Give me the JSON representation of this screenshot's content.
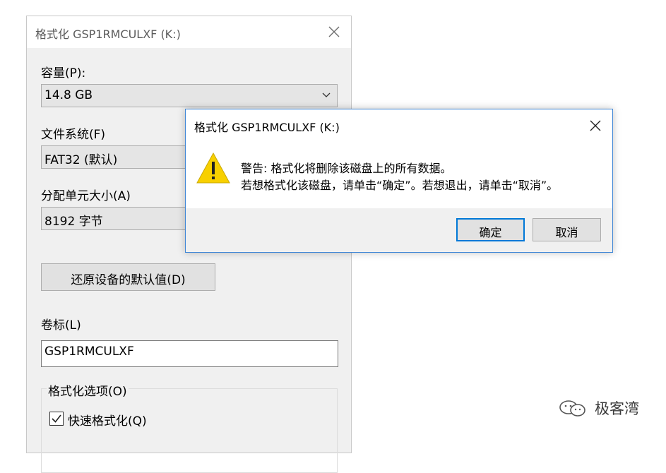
{
  "format_window": {
    "title": "格式化 GSP1RMCULXF (K:)",
    "capacity_label": "容量(P):",
    "capacity_value": "14.8 GB",
    "filesystem_label": "文件系统(F)",
    "filesystem_value": "FAT32 (默认)",
    "allocation_label": "分配单元大小(A)",
    "allocation_value": "8192 字节",
    "restore_defaults_label": "还原设备的默认值(D)",
    "volume_label_label": "卷标(L)",
    "volume_label_value": "GSP1RMCULXF",
    "format_options_label": "格式化选项(O)",
    "quick_format_label": "快速格式化(Q)",
    "quick_format_checked": true
  },
  "warning_dialog": {
    "title": "格式化 GSP1RMCULXF (K:)",
    "icon": "warning-icon",
    "message_line1": "警告: 格式化将删除该磁盘上的所有数据。",
    "message_line2": "若想格式化该磁盘，请单击“确定”。若想退出，请单击“取消”。",
    "ok_label": "确定",
    "cancel_label": "取消"
  },
  "watermark": {
    "text": "极客湾",
    "icon": "wechat-icon"
  },
  "colors": {
    "accent": "#0078d7",
    "dialog_border": "#3f86d6",
    "warning_yellow": "#f8d000"
  }
}
